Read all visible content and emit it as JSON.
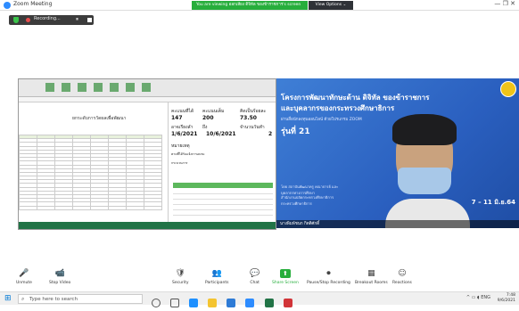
{
  "window": {
    "title": "Zoom Meeting",
    "controls": "—  ❐  ✕"
  },
  "share_banner": {
    "text": "You are viewing ออกเสียง ดิจิทัล ของข้าราชการ's screen",
    "stop_label": "ดู"
  },
  "view_options": "View Options ⌄",
  "recording": {
    "label": "Recording...",
    "pause": "⏸"
  },
  "spreadsheet": {
    "title": "ยกระดับการวัดผลเพื่อพัฒนา",
    "panel": {
      "h1": "คะแนนที่ได้",
      "h2": "คะแนนเต็ม",
      "h3": "คิดเป็นร้อยละ",
      "v1": "147",
      "v2": "200",
      "v3": "73.50",
      "h4": "อาจเรียงลำ",
      "h5": "ถึง",
      "h6": "จำนวนวันทำ",
      "v4": "1/6/2021",
      "v5": "10/6/2021",
      "v6": "2",
      "note1": "หมายเหตุ",
      "note2": "ตามที่ได้รับแจ้งการอบรม",
      "note3": "กระบวนการ"
    }
  },
  "slide": {
    "title_line1": "โครงการพัฒนาทักษะด้าน ดิจิทัล ของข้าราชการ",
    "title_line2": "และบุคลากรของกระทรวงศึกษาธิการ",
    "subtitle": "ผ่านสื่อนักลงทุนออนไลน์ ด้วยโปรแกรม ZOOM",
    "round": "รุ่นที่ 21",
    "dates": "7 – 11 มิ.ย.64",
    "org1": "โดย สถาบันพัฒนาครู คณาจารย์ และบุคลากรทางการศึกษา",
    "org2": "สำนักงานปลัดกระทรวงศึกษาธิการ กระทรวงศึกษาธิการ",
    "namebar": "นางพิมพ์ชนก กิตติศักดิ์"
  },
  "controls": [
    {
      "icon": "🎤",
      "label": "Unmute"
    },
    {
      "icon": "📹",
      "label": "Stop Video"
    },
    {
      "icon": "🛡",
      "label": "Security"
    },
    {
      "icon": "👥",
      "label": "Participants"
    },
    {
      "icon": "💬",
      "label": "Chat"
    },
    {
      "icon": "⬆",
      "label": "Share Screen"
    },
    {
      "icon": "⏺",
      "label": "Pause/Stop Recording"
    },
    {
      "icon": "▦",
      "label": "Breakout Rooms"
    },
    {
      "icon": "☺",
      "label": "Reactions"
    }
  ],
  "taskbar": {
    "search_placeholder": "Type here to search",
    "time": "7:48",
    "date": "9/6/2021",
    "lang": "ENG"
  },
  "colors": {
    "share_green": "#27ae3c",
    "slide_blue": "#2a5fbf"
  }
}
